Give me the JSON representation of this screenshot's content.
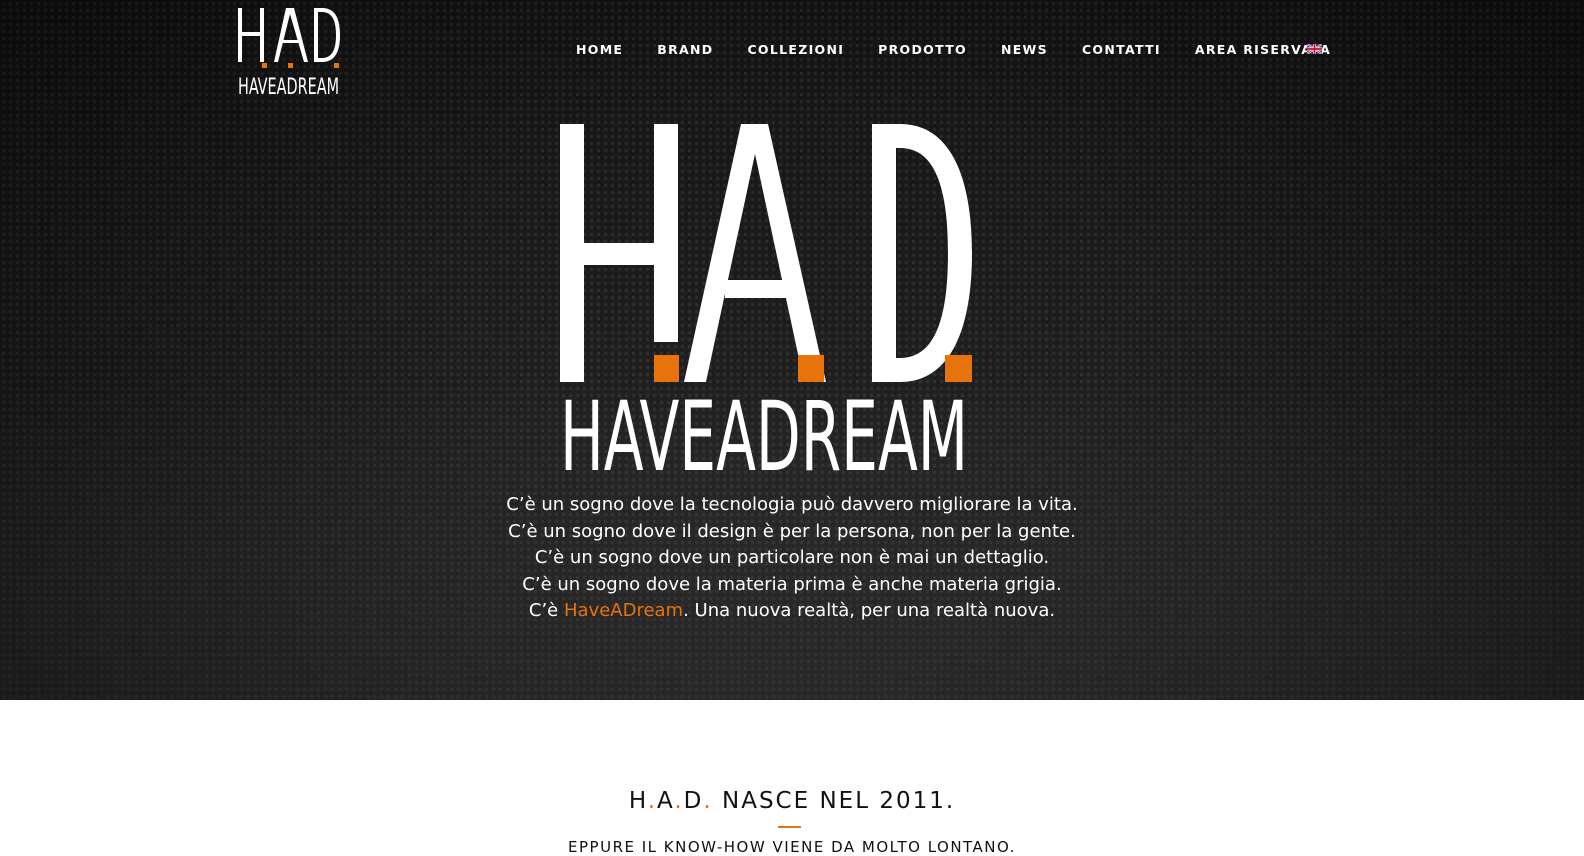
{
  "header": {
    "logo": {
      "letters": [
        "H",
        "A",
        "D"
      ],
      "wordmark": "HAVEADREAM",
      "accent_color": "#e8720c"
    },
    "nav": [
      "HOME",
      "BRAND",
      "COLLEZIONI",
      "PRODOTTO",
      "NEWS",
      "CONTATTI",
      "AREA RISERVATA"
    ],
    "language_flag": "uk-flag-icon"
  },
  "hero": {
    "big_logo": {
      "letters": [
        "H",
        "A",
        "D"
      ],
      "wordmark": "HAVEADREAM"
    },
    "lines": [
      "C’è un sogno dove la tecnologia può davvero migliorare la vita.",
      "C’è un sogno dove il design è per la persona, non per la gente.",
      "C’è un sogno dove un particolare non è mai un dettaglio.",
      "C’è un sogno dove la materia prima è anche materia grigia."
    ],
    "last_line": {
      "prefix": "C’è ",
      "highlight": "HaveADream",
      "suffix": ". Una nuova realtà, per una realtà nuova."
    }
  },
  "section": {
    "title_parts": [
      "H",
      ".",
      "A",
      ".",
      "D",
      "."
    ],
    "title_rest": " NASCE NEL 2011.",
    "subtitle": "EPPURE IL KNOW-HOW VIENE DA MOLTO LONTANO."
  },
  "colors": {
    "accent": "#e8720c",
    "hero_bg": "#1c1c1c",
    "text_light": "#ffffff"
  }
}
